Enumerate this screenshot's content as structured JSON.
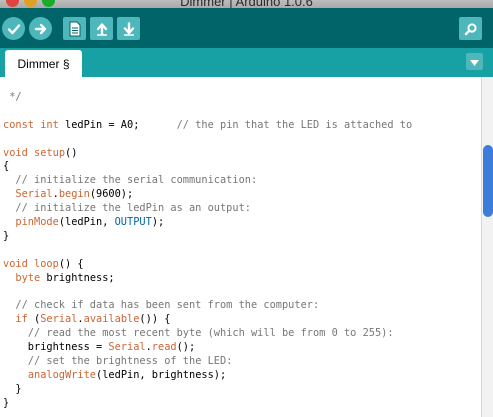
{
  "window": {
    "title": "Dimmer | Arduino 1.0.6"
  },
  "toolbar": {
    "buttons": [
      {
        "name": "verify",
        "icon": "check-icon"
      },
      {
        "name": "upload",
        "icon": "arrow-right-icon"
      },
      {
        "name": "new",
        "icon": "document-icon"
      },
      {
        "name": "open",
        "icon": "arrow-up-icon"
      },
      {
        "name": "save",
        "icon": "arrow-down-icon"
      },
      {
        "name": "serial-monitor",
        "icon": "magnifier-icon"
      }
    ]
  },
  "tabs": [
    {
      "label": "Dimmer §"
    }
  ],
  "colors": {
    "toolbar": "#006468",
    "tabstrip": "#17a1a5",
    "button": "#4db7bb",
    "keyword": "#cc6633",
    "comment": "#777777",
    "constant": "#006699",
    "scroll_thumb": "#3b7dd8"
  },
  "code_lines": [
    [
      {
        "t": " */",
        "c": "cm"
      }
    ],
    [],
    [
      {
        "t": "const",
        "c": "kw"
      },
      {
        "t": " "
      },
      {
        "t": "int",
        "c": "kw"
      },
      {
        "t": " ledPin = A0;      "
      },
      {
        "t": "// the pin that the LED is attached to",
        "c": "cm"
      }
    ],
    [],
    [
      {
        "t": "void",
        "c": "kw"
      },
      {
        "t": " "
      },
      {
        "t": "setup",
        "c": "fn"
      },
      {
        "t": "()"
      }
    ],
    [
      {
        "t": "{"
      }
    ],
    [
      {
        "t": "  "
      },
      {
        "t": "// initialize the serial communication:",
        "c": "cm"
      }
    ],
    [
      {
        "t": "  "
      },
      {
        "t": "Serial",
        "c": "fn"
      },
      {
        "t": "."
      },
      {
        "t": "begin",
        "c": "fn"
      },
      {
        "t": "(9600);"
      }
    ],
    [
      {
        "t": "  "
      },
      {
        "t": "// initialize the ledPin as an output:",
        "c": "cm"
      }
    ],
    [
      {
        "t": "  "
      },
      {
        "t": "pinMode",
        "c": "fn"
      },
      {
        "t": "(ledPin, "
      },
      {
        "t": "OUTPUT",
        "c": "cst"
      },
      {
        "t": ");"
      }
    ],
    [
      {
        "t": "}"
      }
    ],
    [],
    [
      {
        "t": "void",
        "c": "kw"
      },
      {
        "t": " "
      },
      {
        "t": "loop",
        "c": "fn"
      },
      {
        "t": "() {"
      }
    ],
    [
      {
        "t": "  "
      },
      {
        "t": "byte",
        "c": "kw"
      },
      {
        "t": " brightness;"
      }
    ],
    [],
    [
      {
        "t": "  "
      },
      {
        "t": "// check if data has been sent from the computer:",
        "c": "cm"
      }
    ],
    [
      {
        "t": "  "
      },
      {
        "t": "if",
        "c": "kw"
      },
      {
        "t": " ("
      },
      {
        "t": "Serial",
        "c": "fn"
      },
      {
        "t": "."
      },
      {
        "t": "available",
        "c": "fn"
      },
      {
        "t": "()) {"
      }
    ],
    [
      {
        "t": "    "
      },
      {
        "t": "// read the most recent byte (which will be from 0 to 255):",
        "c": "cm"
      }
    ],
    [
      {
        "t": "    brightness = "
      },
      {
        "t": "Serial",
        "c": "fn"
      },
      {
        "t": "."
      },
      {
        "t": "read",
        "c": "fn"
      },
      {
        "t": "();"
      }
    ],
    [
      {
        "t": "    "
      },
      {
        "t": "// set the brightness of the LED:",
        "c": "cm"
      }
    ],
    [
      {
        "t": "    "
      },
      {
        "t": "analogWrite",
        "c": "fn"
      },
      {
        "t": "(ledPin, brightness);"
      }
    ],
    [
      {
        "t": "  }"
      }
    ],
    [
      {
        "t": "}"
      }
    ]
  ]
}
